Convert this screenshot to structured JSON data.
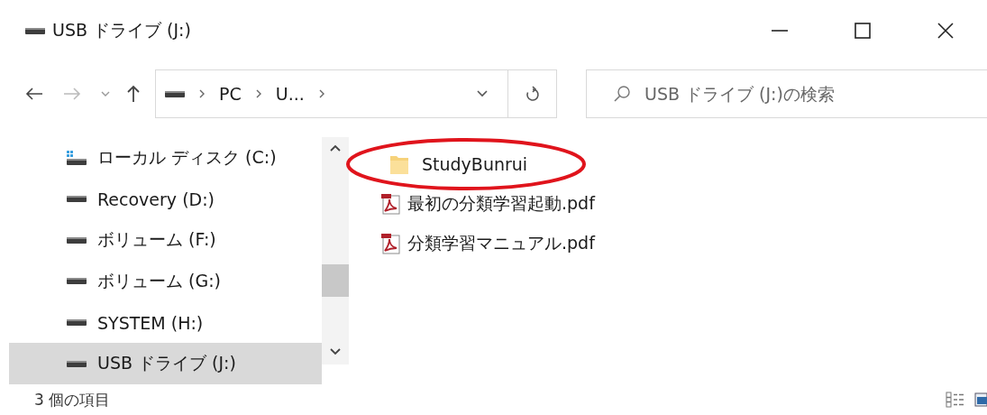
{
  "window": {
    "title": "USB ドライブ (J:)"
  },
  "address": {
    "segments": [
      "PC",
      "U..."
    ]
  },
  "search": {
    "placeholder": "USB ドライブ (J:)の検索"
  },
  "sidebar": {
    "items": [
      {
        "label": "ローカル ディスク (C:)",
        "kind": "system",
        "selected": false
      },
      {
        "label": "Recovery (D:)",
        "kind": "drive",
        "selected": false
      },
      {
        "label": "ボリューム (F:)",
        "kind": "drive",
        "selected": false
      },
      {
        "label": "ボリューム (G:)",
        "kind": "drive",
        "selected": false
      },
      {
        "label": "SYSTEM (H:)",
        "kind": "drive",
        "selected": false
      },
      {
        "label": "USB ドライブ (J:)",
        "kind": "drive",
        "selected": true
      }
    ]
  },
  "files": [
    {
      "name": "StudyBunrui",
      "kind": "folder",
      "circled": true
    },
    {
      "name": "最初の分類学習起動.pdf",
      "kind": "pdf",
      "circled": false
    },
    {
      "name": "分類学習マニュアル.pdf",
      "kind": "pdf",
      "circled": false
    }
  ],
  "status_bar": {
    "count": "3 個の項目"
  }
}
